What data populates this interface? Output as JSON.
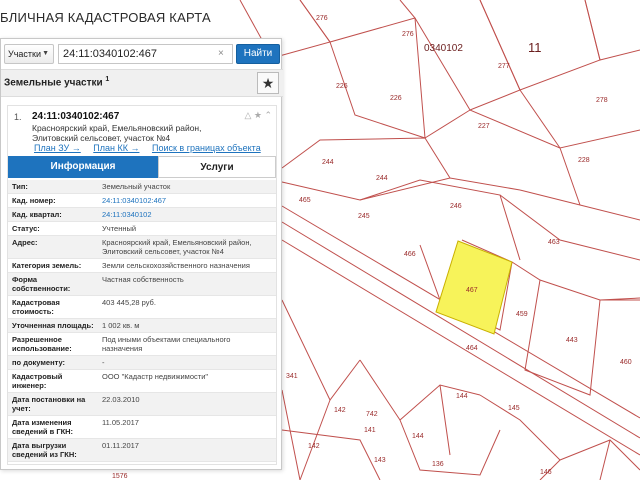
{
  "app": {
    "title": "БЛИЧНАЯ КАДАСТРОВАЯ КАРТА"
  },
  "search": {
    "type_label": "Участки",
    "value": "24:11:0340102:467",
    "clear_symbol": "×",
    "button_label": "Найти"
  },
  "section": {
    "title": "Земельные участки",
    "count_sup": "1",
    "fav_symbol": "★"
  },
  "result": {
    "number": "1.",
    "cadastral_id": "24:11:0340102:467",
    "address": "Красноярский край, Емельяновский район, Элитовский сельсовет, участок №4",
    "icons": "△ ★ ⌃",
    "links": [
      "План ЗУ →",
      "План КК →",
      "Поиск в границах объекта →"
    ]
  },
  "tabs": {
    "info": "Информация",
    "services": "Услуги"
  },
  "attributes": [
    {
      "label": "Тип:",
      "value": "Земельный участок"
    },
    {
      "label": "Кад. номер:",
      "value": "24:11:0340102:467",
      "link": true
    },
    {
      "label": "Кад. квартал:",
      "value": "24:11:0340102",
      "link": true
    },
    {
      "label": "Статус:",
      "value": "Учтенный"
    },
    {
      "label": "Адрес:",
      "value": "Красноярский край, Емельяновский район, Элитовский сельсовет, участок №4"
    },
    {
      "label": "Категория земель:",
      "value": "Земли сельскохозяйственного назначения"
    },
    {
      "label": "Форма собственности:",
      "value": "Частная собственность"
    },
    {
      "label": "Кадастровая стоимость:",
      "value": "403 445,28 руб."
    },
    {
      "label": "Уточненная площадь:",
      "value": "1 002 кв. м"
    },
    {
      "label": "Разрешенное использование:",
      "value": "Под иными объектами специального назначения"
    },
    {
      "label": "по документу:",
      "value": "-"
    },
    {
      "label": "Кадастровый инженер:",
      "value": "ООО \"Кадастр недвижимости\""
    },
    {
      "label": "Дата постановки на учет:",
      "value": "22.03.2010"
    },
    {
      "label": "Дата изменения сведений в ГКН:",
      "value": "11.05.2017"
    },
    {
      "label": "Дата выгрузки сведений из ГКН:",
      "value": "01.11.2017"
    }
  ],
  "map": {
    "block_label": "11",
    "quarter_label": "0340102",
    "parcel_labels": [
      "276",
      "276",
      "277",
      "226",
      "226",
      "278",
      "227",
      "228",
      "244",
      "244",
      "465",
      "245",
      "246",
      "463",
      "466",
      "467",
      "459",
      "443",
      "460",
      "464",
      "341",
      "144",
      "145",
      "142",
      "742",
      "141",
      "144",
      "142",
      "143",
      "136",
      "146",
      "1576"
    ],
    "colors": {
      "parcel_line": "#c0392b",
      "selected_fill": "#f7f35a",
      "selected_stroke": "#c9b000"
    }
  }
}
